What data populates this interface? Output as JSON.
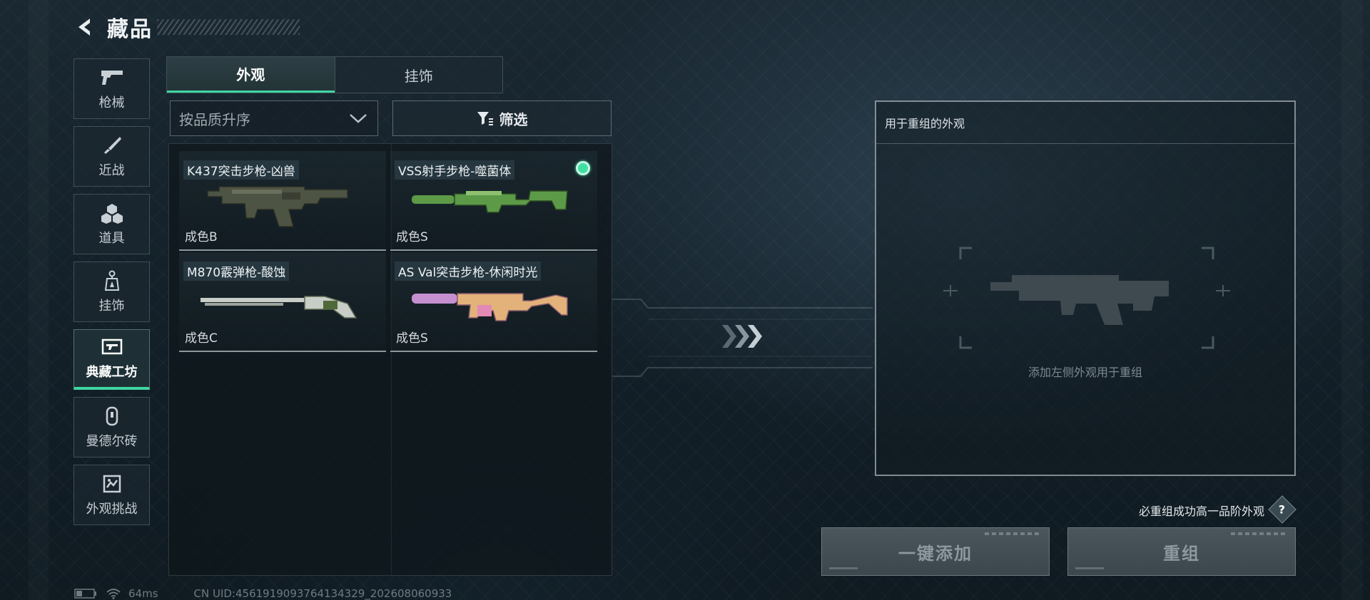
{
  "header": {
    "title": "藏品"
  },
  "sidebar": {
    "items": [
      {
        "label": "枪械",
        "icon": "pistol-icon"
      },
      {
        "label": "近战",
        "icon": "knife-icon"
      },
      {
        "label": "道具",
        "icon": "cubes-icon"
      },
      {
        "label": "挂饰",
        "icon": "charm-icon"
      },
      {
        "label": "典藏工坊",
        "icon": "gun-frame-icon",
        "active": true
      },
      {
        "label": "曼德尔砖",
        "icon": "brick-icon"
      },
      {
        "label": "外观挑战",
        "icon": "challenge-icon"
      }
    ]
  },
  "tabs": [
    {
      "label": "外观",
      "active": true
    },
    {
      "label": "挂饰",
      "active": false
    }
  ],
  "sort": {
    "value": "按品质升序"
  },
  "filter": {
    "label": "筛选"
  },
  "items": [
    {
      "name": "K437突击步枪-凶兽",
      "quality": "成色B",
      "selected": false,
      "gun_color": "#4e5443"
    },
    {
      "name": "VSS射手步枪-噬菌体",
      "quality": "成色S",
      "selected": true,
      "gun_color": "#5c9a48"
    },
    {
      "name": "M870霰弹枪-酸蚀",
      "quality": "成色C",
      "selected": false,
      "gun_color": "#c9cdc8"
    },
    {
      "name": "AS Val突击步枪-休闲时光",
      "quality": "成色S",
      "selected": false,
      "gun_color": "#e2b27a"
    }
  ],
  "recombine": {
    "header": "用于重组的外观",
    "hint": "添加左侧外观用于重组"
  },
  "rule_text": "必重组成功高一品阶外观",
  "help_label": "?",
  "buttons": {
    "add_all": "一键添加",
    "recombine": "重组"
  },
  "status": {
    "ping": "64ms",
    "uid": "CN UID:4561919093764134329_202608060933"
  },
  "colors": {
    "accent": "#3fd6a1",
    "selected_dot": "#3fe0a2"
  }
}
